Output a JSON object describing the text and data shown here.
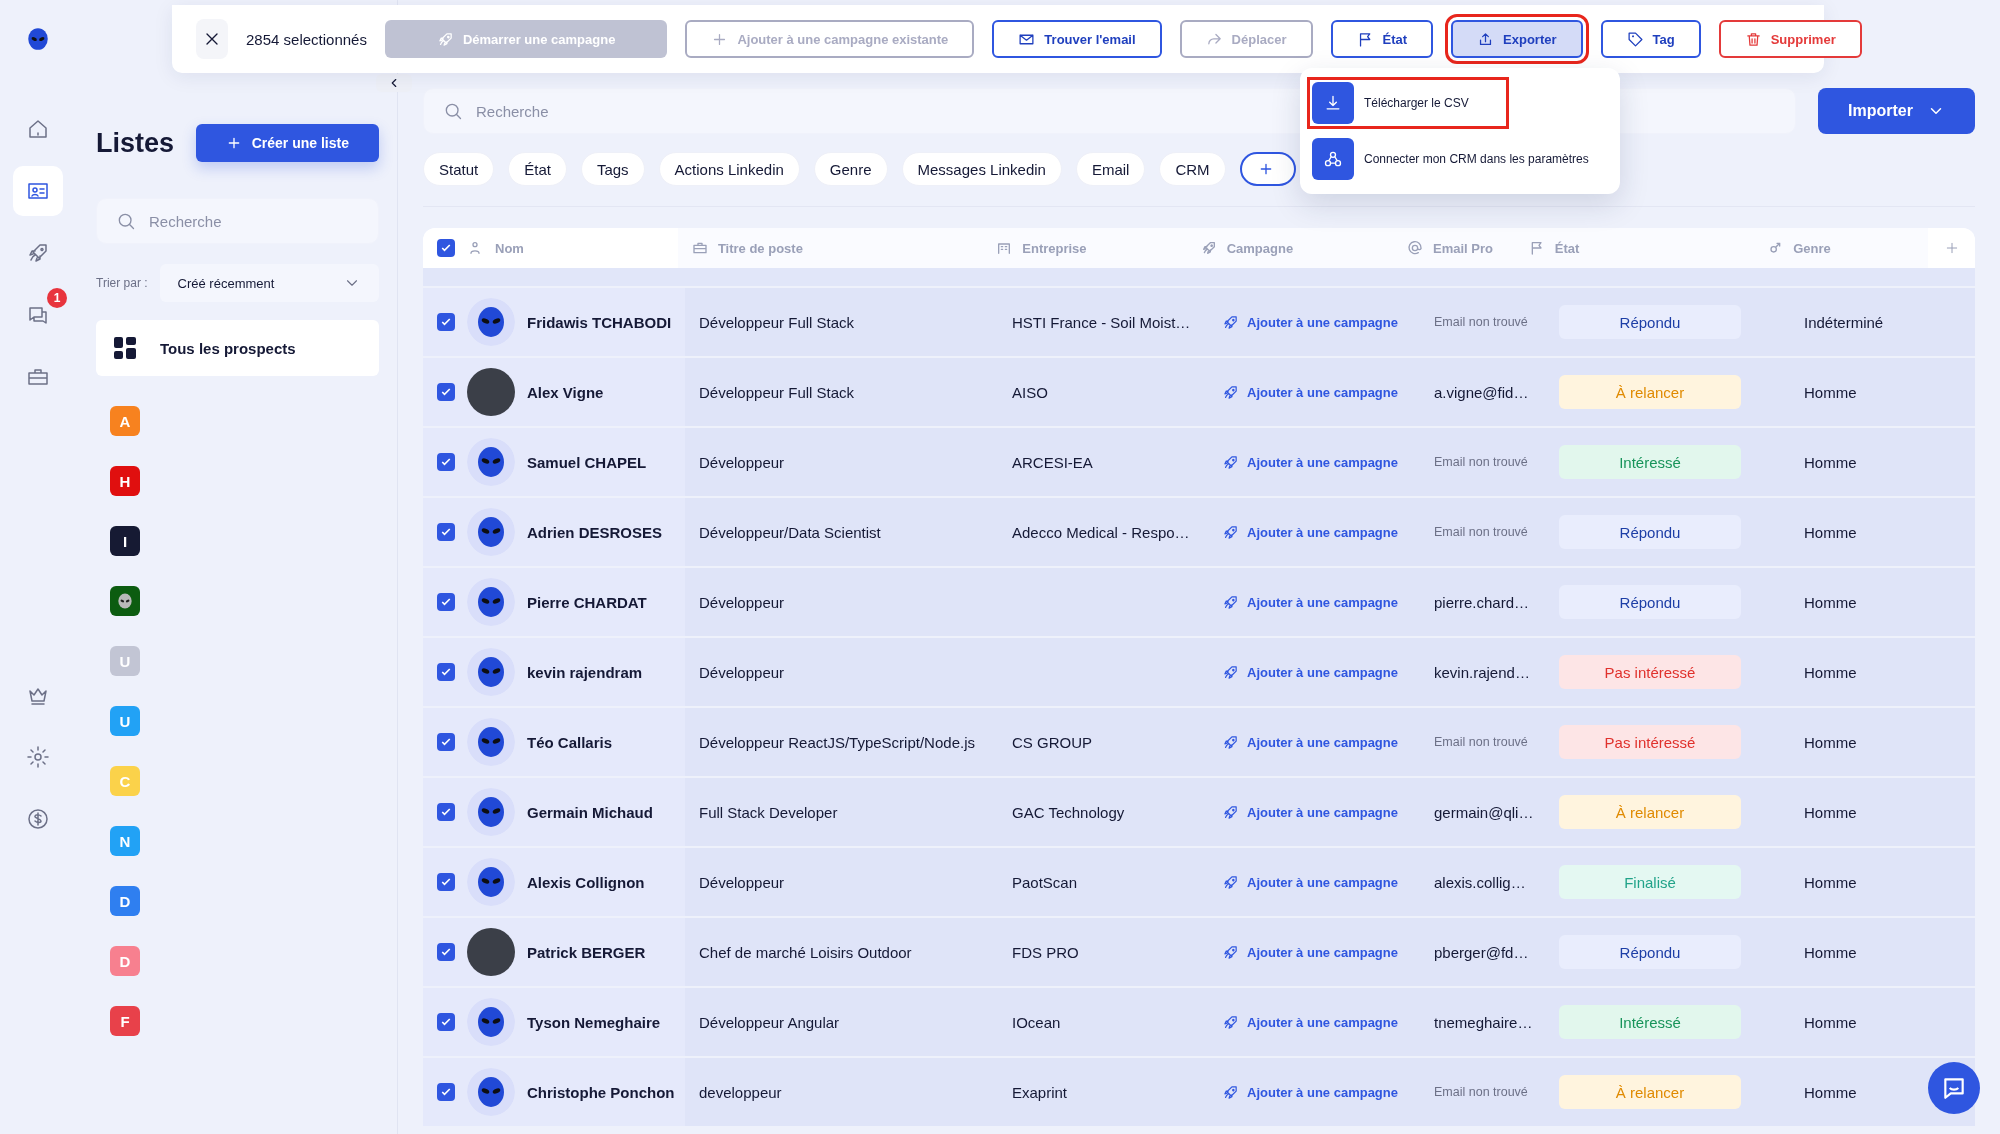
{
  "nav": [
    {
      "selected": false
    },
    {
      "selected": true
    },
    {
      "selected": false
    },
    {
      "selected": false,
      "badge": "1"
    },
    {
      "selected": false
    },
    {
      "selected": false
    },
    {
      "selected": false
    },
    {
      "selected": false
    }
  ],
  "selection_bar": {
    "count": "2854 selectionnés",
    "buttons": [
      {
        "label": "Démarrer une campagne",
        "kind": "disabled",
        "highlighted": false
      },
      {
        "label": "Ajouter à une campagne existante",
        "kind": "muted",
        "highlighted": false
      },
      {
        "label": "Trouver l'email",
        "kind": "primary",
        "highlighted": false
      },
      {
        "label": "Déplacer",
        "kind": "muted",
        "highlighted": false
      },
      {
        "label": "État",
        "kind": "primary",
        "highlighted": false
      },
      {
        "label": "Exporter",
        "kind": "active",
        "highlighted": true
      },
      {
        "label": "Tag",
        "kind": "primary",
        "highlighted": false
      },
      {
        "label": "Supprimer",
        "kind": "danger",
        "highlighted": false
      }
    ]
  },
  "export_menu": [
    {
      "label": "Télécharger le CSV",
      "highlighted": true
    },
    {
      "label": "Connecter mon CRM dans les paramètres",
      "highlighted": false
    }
  ],
  "lists_panel": {
    "title": "Listes",
    "create_button": "Créer une liste",
    "search_placeholder": "Recherche",
    "sort_label": "Trier par :",
    "sort_value": "Créé récemment",
    "all_prospects": "Tous les prospects",
    "lists": [
      {
        "kind": "letter",
        "letter": "A",
        "color": "#f7821f"
      },
      {
        "kind": "letter",
        "letter": "H",
        "color": "#e00f0f"
      },
      {
        "kind": "letter",
        "letter": "I",
        "color": "#161a33"
      },
      {
        "kind": "icon",
        "color": "#0c5c10"
      },
      {
        "kind": "letter",
        "letter": "U",
        "color": "#c2c5d4"
      },
      {
        "kind": "letter",
        "letter": "U",
        "color": "#22a2f5"
      },
      {
        "kind": "letter",
        "letter": "C",
        "color": "#fbd24a"
      },
      {
        "kind": "letter",
        "letter": "N",
        "color": "#22a2f5"
      },
      {
        "kind": "letter",
        "letter": "D",
        "color": "#2f7ff0"
      },
      {
        "kind": "letter",
        "letter": "D",
        "color": "#f7808f"
      },
      {
        "kind": "letter",
        "letter": "F",
        "color": "#e8414a"
      }
    ]
  },
  "search": {
    "placeholder": "Recherche"
  },
  "import_button": "Importer",
  "filters": [
    "Statut",
    "État",
    "Tags",
    "Actions Linkedin",
    "Genre",
    "Messages Linkedin",
    "Email",
    "CRM"
  ],
  "table": {
    "all_checked": true,
    "columns": [
      "Nom",
      "Titre de poste",
      "Entreprise",
      "Campagne",
      "Email Pro",
      "État",
      "Genre"
    ],
    "rows": [
      {
        "checked": true,
        "avatar": {
          "kind": "alien"
        },
        "name": "Fridawis TCHABODI",
        "title": "Développeur Full Stack",
        "company": "HSTI France - Soil Moist…",
        "campaign": "Ajouter à une campagne",
        "email": "Email non trouvé",
        "email_found": false,
        "status": {
          "label": "Répondu",
          "kind": "replied"
        },
        "gender": "Indéterminé"
      },
      {
        "checked": true,
        "avatar": {
          "kind": "photo"
        },
        "name": "Alex Vigne",
        "title": "Développeur Full Stack",
        "company": "AISO",
        "campaign": "Ajouter à une campagne",
        "email": "a.vigne@fid…",
        "email_found": true,
        "status": {
          "label": "À relancer",
          "kind": "follow_up"
        },
        "gender": "Homme"
      },
      {
        "checked": true,
        "avatar": {
          "kind": "alien"
        },
        "name": "Samuel CHAPEL",
        "title": "Développeur",
        "company": "ARCESI-EA",
        "campaign": "Ajouter à une campagne",
        "email": "Email non trouvé",
        "email_found": false,
        "status": {
          "label": "Intéressé",
          "kind": "interested"
        },
        "gender": "Homme"
      },
      {
        "checked": true,
        "avatar": {
          "kind": "alien"
        },
        "name": "Adrien DESROSES",
        "title": "Développeur/Data Scientist",
        "company": "Adecco Medical - Respo…",
        "campaign": "Ajouter à une campagne",
        "email": "Email non trouvé",
        "email_found": false,
        "status": {
          "label": "Répondu",
          "kind": "replied"
        },
        "gender": "Homme"
      },
      {
        "checked": true,
        "avatar": {
          "kind": "alien"
        },
        "name": "Pierre CHARDAT",
        "title": "Développeur",
        "campaign": "Ajouter à une campagne",
        "email": "pierre.chard…",
        "email_found": true,
        "status": {
          "label": "Répondu",
          "kind": "replied"
        },
        "gender": "Homme"
      },
      {
        "checked": true,
        "avatar": {
          "kind": "alien"
        },
        "name": "kevin rajendram",
        "title": "Développeur",
        "campaign": "Ajouter à une campagne",
        "email": "kevin.rajend…",
        "email_found": true,
        "status": {
          "label": "Pas intéressé",
          "kind": "not_interested"
        },
        "gender": "Homme"
      },
      {
        "checked": true,
        "avatar": {
          "kind": "alien"
        },
        "name": "Téo Callaris",
        "title": "Développeur ReactJS/TypeScript/Node.js",
        "company": "CS GROUP",
        "campaign": "Ajouter à une campagne",
        "email": "Email non trouvé",
        "email_found": false,
        "status": {
          "label": "Pas intéressé",
          "kind": "not_interested"
        },
        "gender": "Homme"
      },
      {
        "checked": true,
        "avatar": {
          "kind": "alien"
        },
        "name": "Germain Michaud",
        "title": "Full Stack Developer",
        "company": "GAC Technology",
        "campaign": "Ajouter à une campagne",
        "email": "germain@qli…",
        "email_found": true,
        "status": {
          "label": "À relancer",
          "kind": "follow_up"
        },
        "gender": "Homme"
      },
      {
        "checked": true,
        "avatar": {
          "kind": "alien"
        },
        "name": "Alexis Collignon",
        "title": "Développeur",
        "company": "PaotScan",
        "campaign": "Ajouter à une campagne",
        "email": "alexis.collig…",
        "email_found": true,
        "status": {
          "label": "Finalisé",
          "kind": "done"
        },
        "gender": "Homme"
      },
      {
        "checked": true,
        "avatar": {
          "kind": "photo"
        },
        "name": "Patrick BERGER",
        "title": "Chef de marché Loisirs Outdoor",
        "company": "FDS PRO",
        "campaign": "Ajouter à une campagne",
        "email": "pberger@fd…",
        "email_found": true,
        "status": {
          "label": "Répondu",
          "kind": "replied"
        },
        "gender": "Homme"
      },
      {
        "checked": true,
        "avatar": {
          "kind": "alien"
        },
        "name": "Tyson Nemeghaire",
        "title": "Développeur Angular",
        "company": "IOcean",
        "campaign": "Ajouter à une campagne",
        "email": "tnemeghaire…",
        "email_found": true,
        "status": {
          "label": "Intéressé",
          "kind": "interested"
        },
        "gender": "Homme"
      },
      {
        "checked": true,
        "avatar": {
          "kind": "alien"
        },
        "name": "Christophe Ponchon",
        "title": "developpeur",
        "company": "Exaprint",
        "campaign": "Ajouter à une campagne",
        "email": "Email non trouvé",
        "email_found": false,
        "status": {
          "label": "À relancer",
          "kind": "follow_up"
        },
        "gender": "Homme"
      }
    ]
  }
}
